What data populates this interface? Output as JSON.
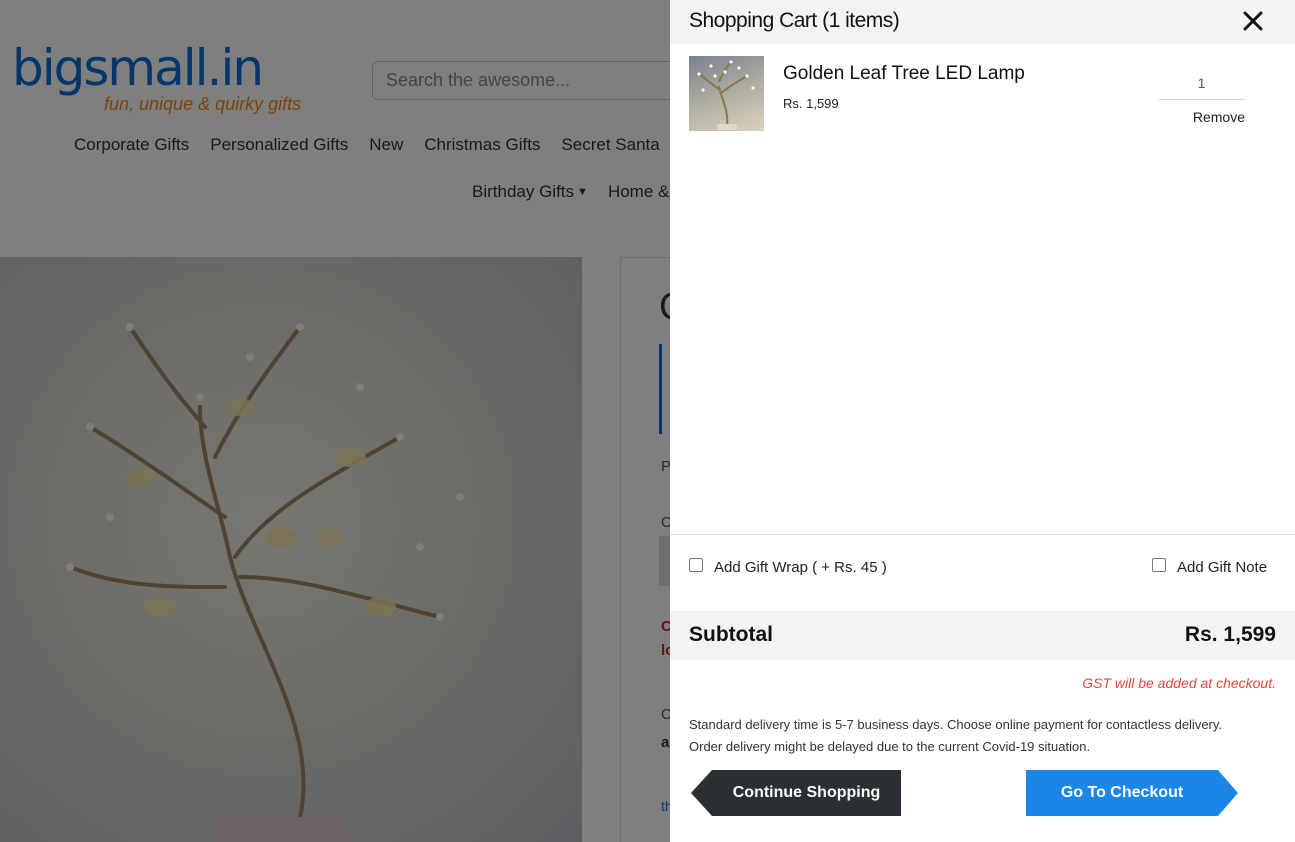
{
  "background_page": {
    "logo": {
      "name": "bigsmall.in",
      "tagline": "fun, unique & quirky gifts"
    },
    "search": {
      "placeholder": "Search the awesome..."
    },
    "nav_primary": [
      "Corporate Gifts",
      "Personalized Gifts",
      "New",
      "Christmas Gifts",
      "Secret Santa"
    ],
    "nav_secondary": [
      "Birthday Gifts",
      "Home &"
    ],
    "card_fragments": {
      "p": "P",
      "o": "O",
      "red1": "C",
      "red2": "lo",
      "c": "C",
      "a": "a",
      "th": "th"
    }
  },
  "cart": {
    "title": "Shopping Cart (1 items)",
    "close_icon": "close-icon",
    "items": [
      {
        "name": "Golden Leaf Tree LED Lamp",
        "price": "Rs. 1,599",
        "quantity": "1",
        "remove_label": "Remove"
      }
    ],
    "gift_wrap_label": "Add Gift Wrap ( + Rs. 45 )",
    "gift_note_label": "Add Gift Note",
    "subtotal_label": "Subtotal",
    "subtotal_value": "Rs. 1,599",
    "gst_note": "GST will be added at checkout.",
    "delivery_note_line1": "Standard delivery time is 5-7 business days. Choose online payment for contactless delivery.",
    "delivery_note_line2": "Order delivery might be delayed due to the current Covid-19 situation.",
    "continue_label": "Continue Shopping",
    "checkout_label": "Go To Checkout"
  },
  "colors": {
    "brand_blue": "#0c6ad6",
    "brand_orange": "#f28b1a",
    "checkout_button": "#1a86e6",
    "continue_button": "#2b2f33",
    "gst_note": "#e5463f",
    "overlay": "rgba(0,0,0,0.5)"
  }
}
